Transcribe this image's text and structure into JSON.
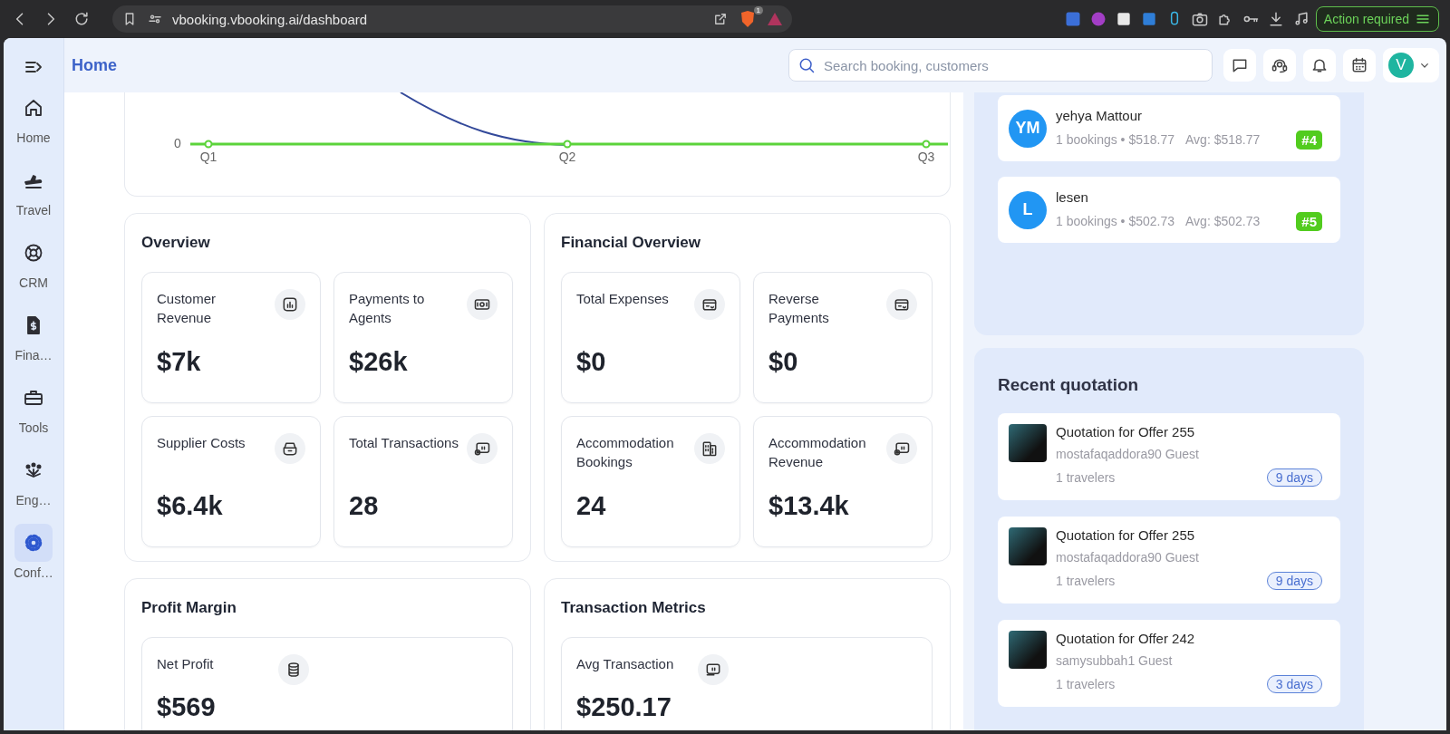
{
  "browser": {
    "url": "vbooking.vbooking.ai/dashboard",
    "shield_badge": "1",
    "action_button": "Action required"
  },
  "sidebar": {
    "items": [
      {
        "label": "Home",
        "selected": false
      },
      {
        "label": "Travel",
        "selected": false
      },
      {
        "label": "CRM",
        "selected": false
      },
      {
        "label": "Fina…",
        "selected": false
      },
      {
        "label": "Tools",
        "selected": false
      },
      {
        "label": "Eng…",
        "selected": false
      },
      {
        "label": "Conf…",
        "selected": true
      }
    ]
  },
  "header": {
    "title": "Home",
    "search": {
      "placeholder": "Search booking, customers"
    },
    "avatar": "V"
  },
  "chart_fragment": {
    "y_label": "0",
    "x_labels": [
      "Q1",
      "Q2",
      "Q3"
    ]
  },
  "sections": [
    {
      "title": "Overview",
      "stats": [
        {
          "label": "Customer Revenue",
          "value": "$7k"
        },
        {
          "label": "Payments to Agents",
          "value": "$26k"
        },
        {
          "label": "Supplier Costs",
          "value": "$6.4k"
        },
        {
          "label": "Total Transactions",
          "value": "28"
        }
      ]
    },
    {
      "title": "Financial Overview",
      "stats": [
        {
          "label": "Total Expenses",
          "value": "$0"
        },
        {
          "label": "Reverse Payments",
          "value": "$0"
        },
        {
          "label": "Accommodation Bookings",
          "value": "24"
        },
        {
          "label": "Accommodation Revenue",
          "value": "$13.4k"
        }
      ]
    },
    {
      "title": "Profit Margin",
      "stats": [
        {
          "label": "Net Profit",
          "value": "$569"
        }
      ]
    },
    {
      "title": "Transaction Metrics",
      "stats": [
        {
          "label": "Avg Transaction",
          "value": "$250.17"
        }
      ]
    }
  ],
  "top_customers": [
    {
      "initials": "YM",
      "name": "yehya Mattour",
      "stats": "1 bookings • $518.77",
      "avg": "Avg: $518.77",
      "rank": "#4"
    },
    {
      "initials": "L",
      "name": "lesen",
      "stats": "1 bookings • $502.73",
      "avg": "Avg: $502.73",
      "rank": "#5"
    }
  ],
  "recent_quotation": {
    "title": "Recent quotation",
    "items": [
      {
        "title": "Quotation for Offer 255",
        "guest": "mostafaqaddora90 Guest",
        "travelers": "1 travelers",
        "age": "9 days"
      },
      {
        "title": "Quotation for Offer 255",
        "guest": "mostafaqaddora90 Guest",
        "travelers": "1 travelers",
        "age": "9 days"
      },
      {
        "title": "Quotation for Offer 242",
        "guest": "samysubbah1 Guest",
        "travelers": "1 travelers",
        "age": "3 days"
      }
    ]
  }
}
